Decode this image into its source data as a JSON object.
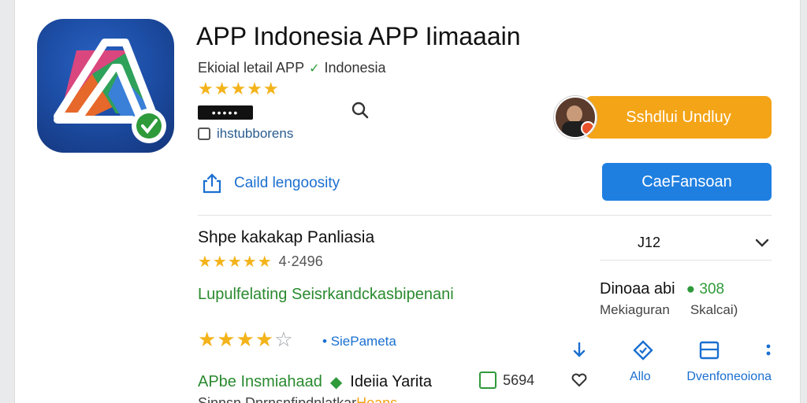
{
  "app": {
    "title": "APP Indonesia APP Iimaaain",
    "subtitle": "Ekioial letail APP",
    "subtitle_verified": "Indonesia",
    "rating_stars": "★★★★★",
    "dots_label": "•••••",
    "meta": "ihstubborens"
  },
  "install": {
    "label": "Sshdlui Undluy"
  },
  "share": {
    "label": "Caild lengoosity"
  },
  "primary_action": {
    "label": "CaeFansoan"
  },
  "section": {
    "title": "Shpe kakakap Panliasia",
    "stars": "★★★★★",
    "rating_text": "4·2496",
    "green_text": "Lupulfelating Seisrkandckasbipenani"
  },
  "version": {
    "value": "J12"
  },
  "download": {
    "label": "Dinoaa abi",
    "value": "308",
    "sub_left": "Mekiaguran",
    "sub_right": "Skalcai)"
  },
  "review": {
    "stars_filled": "★★★★",
    "stars_empty": "☆",
    "link": "SiePameta"
  },
  "actions": {
    "label_1": "Allo",
    "label_2": "Dvenfoneoiona"
  },
  "bottom": {
    "green_text": "APbe Insmiahaad",
    "dark_text": "Ideiia Yarita",
    "number": "5694",
    "cut_text": "Sinnsn Dnrnsnfipdnlatkar",
    "cut_highlight": "Hoans"
  },
  "colors": {
    "accent_orange": "#f4a417",
    "accent_blue": "#1f7fe0",
    "star_yellow": "#f3b31b",
    "green": "#2a8a2f"
  },
  "icons": [
    "app-logo-icon",
    "verified-icon",
    "search-icon",
    "share-icon",
    "chevron-down-icon",
    "download-icon",
    "tag-icon",
    "list-icon",
    "more-icon",
    "heart-icon"
  ]
}
